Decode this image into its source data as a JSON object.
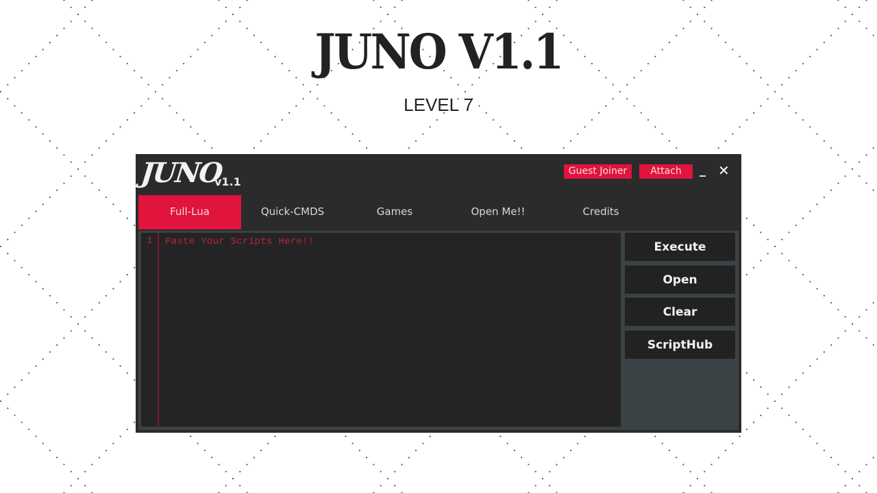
{
  "page": {
    "title": "JUNO V1.1",
    "subtitle": "LEVEL 7"
  },
  "window": {
    "logo_text": "JUNO",
    "version": "v1.1",
    "top_buttons": {
      "guest_joiner": "Guest Joiner",
      "attach": "Attach"
    },
    "controls": {
      "minimize": "_",
      "close": "✕"
    },
    "tabs": [
      {
        "label": "Full-Lua",
        "active": true
      },
      {
        "label": "Quick-CMDS",
        "active": false
      },
      {
        "label": "Games",
        "active": false
      },
      {
        "label": "Open Me!!",
        "active": false
      },
      {
        "label": "Credits",
        "active": false
      }
    ],
    "editor": {
      "line_number": "1",
      "content": "Paste Your Scripts Here!!"
    },
    "side_buttons": {
      "execute": "Execute",
      "open": "Open",
      "clear": "Clear",
      "scripthub": "ScriptHub"
    }
  },
  "colors": {
    "accent": "#e0143c",
    "window_bg": "#2b2b2b",
    "editor_bg": "#242424",
    "editor_text": "#c02238",
    "frame": "#3a4245"
  },
  "icons": {
    "minimize": "minimize-icon",
    "close": "close-icon"
  }
}
